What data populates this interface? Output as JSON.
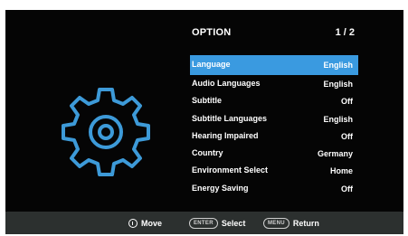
{
  "menu": {
    "title": "OPTION",
    "page": "1 / 2",
    "items": [
      {
        "label": "Language",
        "value": "English"
      },
      {
        "label": "Audio Languages",
        "value": "English"
      },
      {
        "label": "Subtitle",
        "value": "Off"
      },
      {
        "label": "Subtitle Languages",
        "value": "English"
      },
      {
        "label": "Hearing Impaired",
        "value": "Off"
      },
      {
        "label": "Country",
        "value": "Germany"
      },
      {
        "label": "Environment Select",
        "value": "Home"
      },
      {
        "label": "Energy Saving",
        "value": "Off"
      }
    ],
    "selected_index": 0
  },
  "footer": {
    "move_label": "Move",
    "enter_key": "ENTER",
    "select_label": "Select",
    "menu_key": "MENU",
    "return_label": "Return"
  },
  "colors": {
    "highlight": "#3a9ae0",
    "gear": "#3d9ad8",
    "background": "#050505",
    "footer": "#2c302f"
  },
  "icons": {
    "settings": "gear-icon",
    "move": "dpad-icon"
  }
}
